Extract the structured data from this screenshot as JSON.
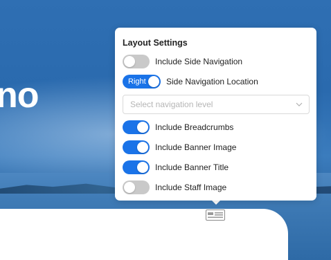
{
  "hero": {
    "title_fragment": "no"
  },
  "layout_settings": {
    "title": "Layout Settings",
    "options": [
      {
        "label": "Include Side Navigation",
        "enabled": false
      },
      {
        "label": "Side Navigation Location",
        "enabled": true,
        "toggle_text": "Right"
      },
      {
        "label": "Include Breadcrumbs",
        "enabled": true
      },
      {
        "label": "Include Banner Image",
        "enabled": true
      },
      {
        "label": "Include Banner Title",
        "enabled": true
      },
      {
        "label": "Include Staff Image",
        "enabled": false
      }
    ],
    "navigation_level_select": {
      "placeholder": "Select navigation level",
      "value": ""
    }
  },
  "colors": {
    "accent": "#1a73e8",
    "toggle_off": "#c9c9c9",
    "panel_background": "#ffffff"
  },
  "icons": {
    "layout_toggle": "layout-panel-icon",
    "select_chevron": "chevron-down-icon"
  }
}
